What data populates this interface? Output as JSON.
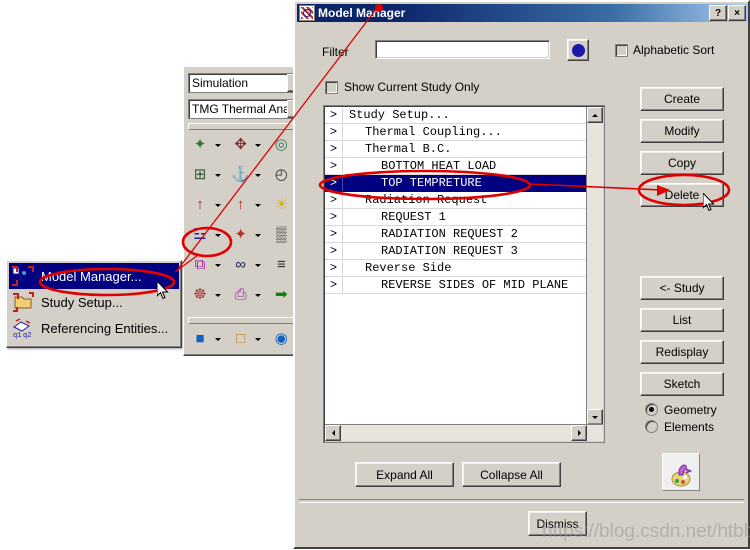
{
  "dialog": {
    "title": "Model Manager",
    "titlebar_icon": "model-manager-icon",
    "help_button": "?",
    "close_button": "×",
    "filter_label": "Filter",
    "filter_value": "",
    "filter_placeholder": "",
    "color_swatch_color": "#1a18a8",
    "alphabetic_sort_label": "Alphabetic Sort",
    "alphabetic_sort_checked": false,
    "show_current_study_only_label": "Show Current Study Only",
    "show_current_study_only_checked": false
  },
  "tree": {
    "rows": [
      {
        "expander": ">",
        "label": "Study Setup...",
        "indent": 0,
        "selected": false
      },
      {
        "expander": ">",
        "label": "Thermal Coupling...",
        "indent": 1,
        "selected": false
      },
      {
        "expander": ">",
        "label": "Thermal B.C.",
        "indent": 1,
        "selected": false
      },
      {
        "expander": ">",
        "label": "BOTTOM HEAT LOAD",
        "indent": 2,
        "selected": false
      },
      {
        "expander": ">",
        "label": "TOP TEMPRETURE",
        "indent": 2,
        "selected": true
      },
      {
        "expander": ">",
        "label": "Radiation Request",
        "indent": 1,
        "selected": false
      },
      {
        "expander": ">",
        "label": "REQUEST 1",
        "indent": 2,
        "selected": false
      },
      {
        "expander": ">",
        "label": "RADIATION REQUEST 2",
        "indent": 2,
        "selected": false
      },
      {
        "expander": ">",
        "label": "RADIATION REQUEST 3",
        "indent": 2,
        "selected": false
      },
      {
        "expander": ">",
        "label": "Reverse Side",
        "indent": 1,
        "selected": false
      },
      {
        "expander": ">",
        "label": "REVERSE SIDES OF MID PLANE",
        "indent": 2,
        "selected": false
      }
    ]
  },
  "side_buttons": {
    "create": "Create",
    "modify": "Modify",
    "copy": "Copy",
    "delete": "Delete",
    "study": "<- Study",
    "list": "List",
    "redisplay": "Redisplay",
    "sketch": "Sketch"
  },
  "display_mode": {
    "geometry_label": "Geometry",
    "elements_label": "Elements",
    "selected": "Geometry"
  },
  "bottom_buttons": {
    "expand_all": "Expand All",
    "collapse_all": "Collapse All",
    "dismiss": "Dismiss"
  },
  "toolbar_panel": {
    "combo_application": "Simulation",
    "combo_solver": "TMG Thermal Anal",
    "icons": [
      {
        "name": "thermal-mesh-icon",
        "glyph": "✦",
        "color": "#2d7a2d",
        "circled": false
      },
      {
        "name": "thermal-coupling-icon",
        "glyph": "✥",
        "color": "#7a2d2d",
        "circled": false
      },
      {
        "name": "radiation-request-icon",
        "glyph": "◎",
        "color": "#2d7a5a",
        "circled": false
      },
      {
        "name": "mesh-control-icon",
        "glyph": "⊞",
        "color": "#2d5a2d",
        "circled": false
      },
      {
        "name": "heat-load-icon",
        "glyph": "⚓",
        "color": "#b03030",
        "circled": false
      },
      {
        "name": "time-history-icon",
        "glyph": "◴",
        "color": "#303030",
        "circled": false
      },
      {
        "name": "boundary-condition-icon",
        "glyph": "↑",
        "color": "#b03030",
        "circled": false
      },
      {
        "name": "thermal-bc-icon",
        "glyph": "↑",
        "color": "#b03030",
        "circled": false
      },
      {
        "name": "solar-load-icon",
        "glyph": "☀",
        "color": "#d8b020",
        "circled": false
      },
      {
        "name": "model-manager-icon",
        "glyph": "☲",
        "color": "#2020a0",
        "circled": true
      },
      {
        "name": "reverse-side-icon",
        "glyph": "✦",
        "color": "#b03030",
        "circled": false
      },
      {
        "name": "table-grid-icon",
        "glyph": "▒",
        "color": "#202020",
        "circled": false
      },
      {
        "name": "copy-study-icon",
        "glyph": "⧉",
        "color": "#a020a0",
        "circled": false
      },
      {
        "name": "link-entities-icon",
        "glyph": "∞",
        "color": "#202060",
        "circled": false
      },
      {
        "name": "report-document-icon",
        "glyph": "≡",
        "color": "#303030",
        "circled": false
      },
      {
        "name": "mesh-cloud-icon",
        "glyph": "☸",
        "color": "#b03030",
        "circled": false
      },
      {
        "name": "extract-data-icon",
        "glyph": "⎙",
        "color": "#a020a0",
        "circled": false
      },
      {
        "name": "solve-arrow-icon",
        "glyph": "➡",
        "color": "#108010",
        "circled": false
      }
    ],
    "icons_bottom": [
      {
        "name": "post-processing-icon",
        "glyph": "■",
        "color": "#1060c0"
      },
      {
        "name": "new-scenario-icon",
        "glyph": "□",
        "color": "#c08020"
      },
      {
        "name": "results-view-icon",
        "glyph": "◉",
        "color": "#1060c0"
      }
    ]
  },
  "context_menu": {
    "items": [
      {
        "label": "Model Manager...",
        "icon": "model-manager-icon",
        "highlighted": true
      },
      {
        "label": "Study Setup...",
        "icon": "study-setup-icon",
        "highlighted": false
      },
      {
        "label": "Referencing Entities...",
        "icon": "referencing-entities-icon",
        "highlighted": false
      }
    ]
  },
  "annotations": {
    "watermark": "https://blog.csdn.net/htbbzzg",
    "highlight_color": "#e00000"
  }
}
